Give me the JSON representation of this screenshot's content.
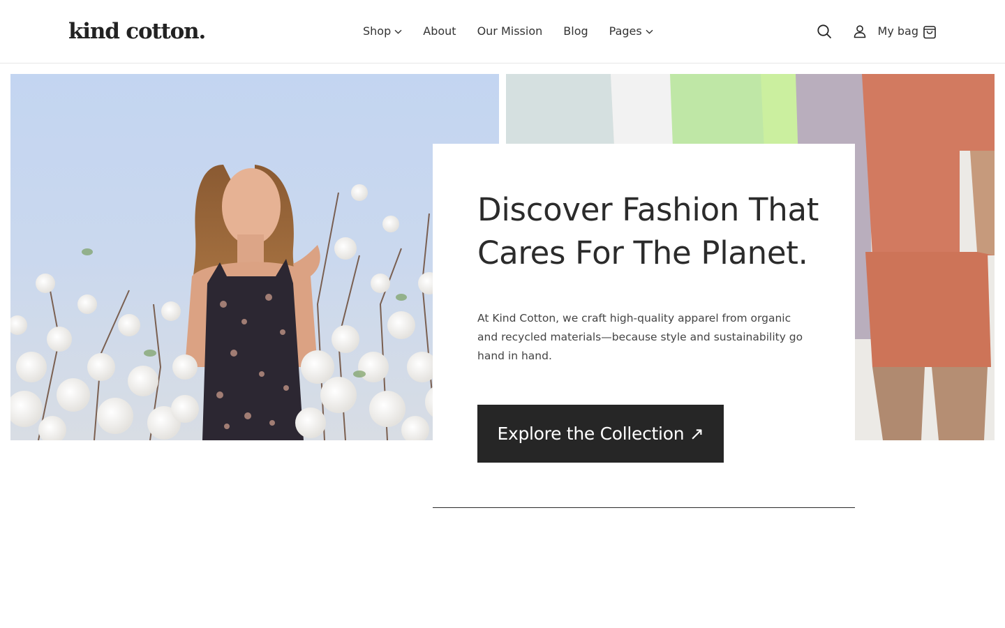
{
  "brand": {
    "logo_text": "kind cotton."
  },
  "nav": {
    "items": [
      {
        "label": "Shop",
        "has_dropdown": true
      },
      {
        "label": "About",
        "has_dropdown": false
      },
      {
        "label": "Our Mission",
        "has_dropdown": false
      },
      {
        "label": "Blog",
        "has_dropdown": false
      },
      {
        "label": "Pages",
        "has_dropdown": true
      }
    ]
  },
  "header_actions": {
    "search_icon": "search-icon",
    "account_icon": "user-icon",
    "bag_label": "My bag",
    "bag_icon": "shopping-bag-icon"
  },
  "hero": {
    "headline_line1": "Discover Fashion That",
    "headline_line2": "Cares For The Planet.",
    "description": "At Kind Cotton, we craft high-quality apparel from organic and recycled materials—because style and sustainability go hand in hand.",
    "cta_label": "Explore the Collection ↗"
  },
  "colors": {
    "text": "#2a2a2a",
    "cta_background": "#262626",
    "cta_text": "#ffffff",
    "header_border": "#e6e6e6"
  }
}
